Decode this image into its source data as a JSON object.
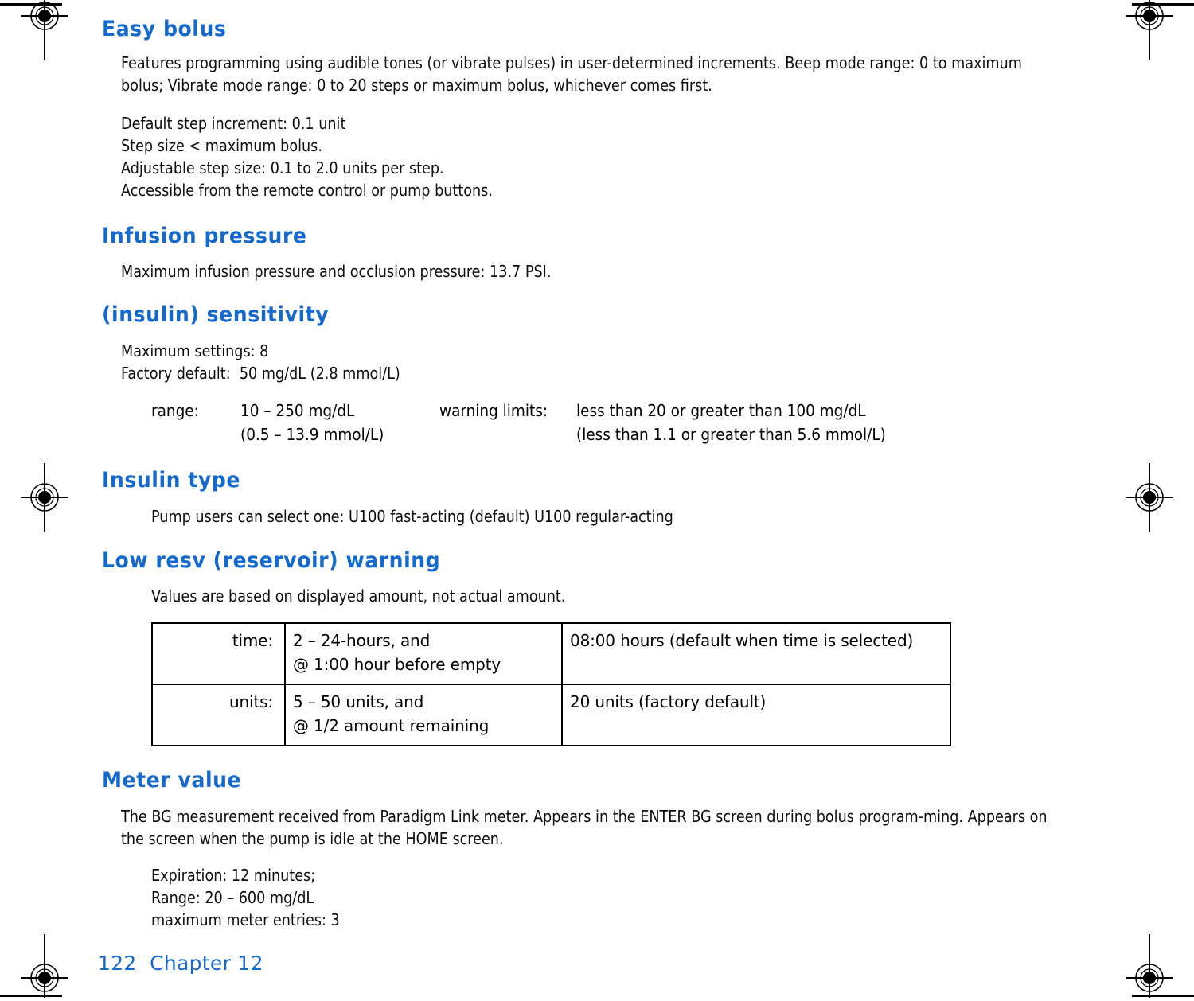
{
  "document": {
    "page_number": "122",
    "chapter": "Chapter 12",
    "footer": "122  Chapter 12",
    "heading_color": "#1469cf",
    "body_color": "#0d0d0d"
  },
  "sections": [
    {
      "id": "easy-bolus",
      "heading": "Easy bolus",
      "paragraph": "Features programming using audible tones (or vibrate pulses) in user-determined increments. Beep mode range: 0 to maximum bolus; Vibrate mode range: 0 to 20 steps or maximum bolus, whichever comes first.",
      "lines": [
        "Default step increment: 0.1 unit",
        "Step size < maximum bolus.",
        "Adjustable step size: 0.1 to 2.0 units per step.",
        "Accessible from the remote control or pump buttons."
      ]
    },
    {
      "id": "infusion-pressure",
      "heading": "Infusion pressure",
      "paragraph": "Maximum infusion pressure and occlusion pressure: 13.7 PSI."
    },
    {
      "id": "insulin-sensitivity",
      "heading": "(insulin) sensitivity",
      "lines": [
        "Maximum settings: 8",
        "Factory default:  50 mg/dL (2.8 mmol/L)"
      ],
      "range_block": {
        "range_label": "range:",
        "range_value_1": "10 – 250 mg/dL",
        "range_value_2": "(0.5 – 13.9 mmol/L)",
        "warning_label": "warning limits:",
        "warning_value_1": "less than 20 or greater than 100 mg/dL",
        "warning_value_2": "(less than 1.1 or greater than 5.6 mmol/L)"
      }
    },
    {
      "id": "insulin-type",
      "heading": "Insulin type",
      "paragraph": "Pump users can select one:  U100 fast-acting (default)  U100 regular-acting"
    },
    {
      "id": "low-resv-warning",
      "heading": "Low resv (reservoir) warning",
      "paragraph": "Values are based on displayed amount, not actual amount.",
      "table": {
        "rows": [
          {
            "label": "time:",
            "range_line1": "2 – 24-hours, and",
            "range_line2": "@ 1:00 hour before empty",
            "default_value": "08:00 hours (default when time is selected)"
          },
          {
            "label": "units:",
            "range_line1": "5 – 50 units, and",
            "range_line2": "@ 1/2 amount remaining",
            "default_value": "20 units (factory default)"
          }
        ]
      }
    },
    {
      "id": "meter-value",
      "heading": "Meter value",
      "paragraph": "The BG measurement received from Paradigm Link meter. Appears in the ENTER BG screen during bolus program-ming. Appears on the screen when the pump is idle at the HOME screen.",
      "lines": [
        "Expiration: 12 minutes;",
        "Range: 20 – 600 mg/dL",
        "maximum meter entries: 3"
      ]
    }
  ]
}
